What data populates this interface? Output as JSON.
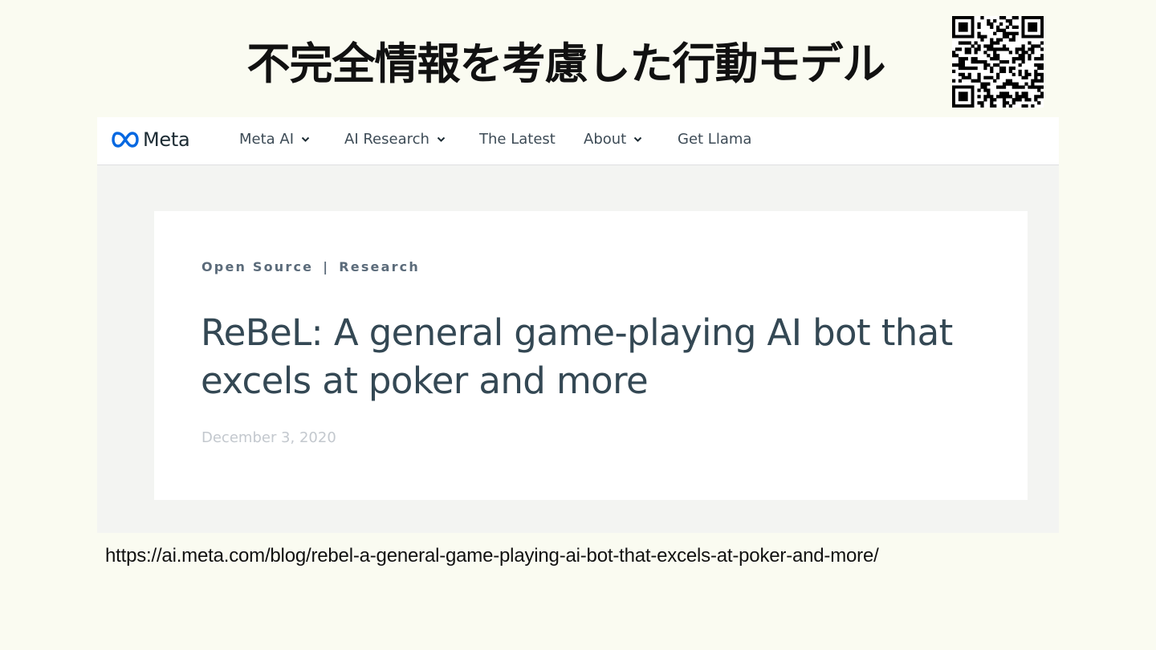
{
  "slide": {
    "title": "不完全情報を考慮した行動モデル",
    "url": "https://ai.meta.com/blog/rebel-a-general-game-playing-ai-bot-that-excels-at-poker-and-more/"
  },
  "site": {
    "logo_text": "Meta",
    "nav": [
      {
        "label": "Meta AI",
        "has_dropdown": true
      },
      {
        "label": "AI Research",
        "has_dropdown": true
      },
      {
        "label": "The Latest",
        "has_dropdown": false
      },
      {
        "label": "About",
        "has_dropdown": true
      },
      {
        "label": "Get Llama",
        "has_dropdown": false
      }
    ]
  },
  "article": {
    "tag_1": "Open Source",
    "tag_separator": "|",
    "tag_2": "Research",
    "headline_line1": "ReBeL: A general game-playing AI bot that",
    "headline_line2": "excels at poker and more",
    "date": "December 3, 2020"
  },
  "colors": {
    "slide_background": "#fafbf1",
    "page_background": "#f3f4f2",
    "headline": "#344854",
    "meta_blue": "#0668e1"
  },
  "icons": {
    "qr": "qr-code-icon",
    "logo": "meta-infinity-logo-icon",
    "dropdown": "chevron-down-icon"
  }
}
